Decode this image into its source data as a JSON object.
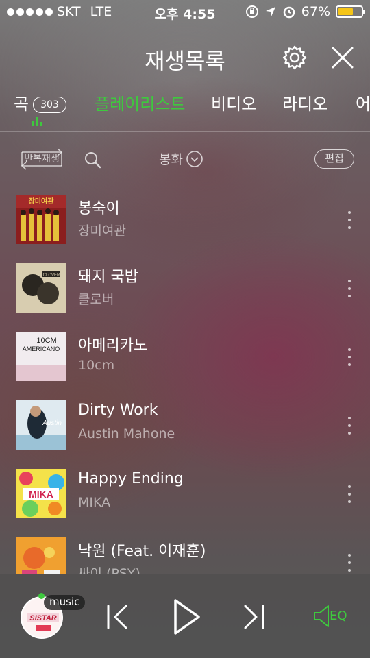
{
  "status_bar": {
    "carrier": "SKT",
    "network": "LTE",
    "time": "오후 4:55",
    "battery_percent": "67%",
    "battery_level": 0.67
  },
  "header": {
    "title": "재생목록",
    "icons": [
      "gear-icon",
      "close-icon"
    ]
  },
  "tabs": [
    {
      "label": "곡",
      "count": "303"
    },
    {
      "label": "플레이리스트",
      "active": true
    },
    {
      "label": "비디오"
    },
    {
      "label": "라디오"
    },
    {
      "label": "어"
    }
  ],
  "toolbar": {
    "repeat_label": "반복재생",
    "sort_label": "봉화",
    "edit_label": "편집"
  },
  "songs": [
    {
      "title": "봉숙이",
      "artist": "장미여관"
    },
    {
      "title": "돼지 국밥",
      "artist": "클로버"
    },
    {
      "title": "아메리카노",
      "artist": "10cm"
    },
    {
      "title": "Dirty Work",
      "artist": "Austin Mahone"
    },
    {
      "title": "Happy Ending",
      "artist": "MIKA"
    },
    {
      "title": "낙원 (Feat. 이재훈)",
      "artist": "싸이 (PSY)"
    }
  ],
  "player": {
    "badge": "music",
    "eq_label": "EQ"
  },
  "colors": {
    "accent": "#3ec93e",
    "battery": "#f5c518"
  }
}
